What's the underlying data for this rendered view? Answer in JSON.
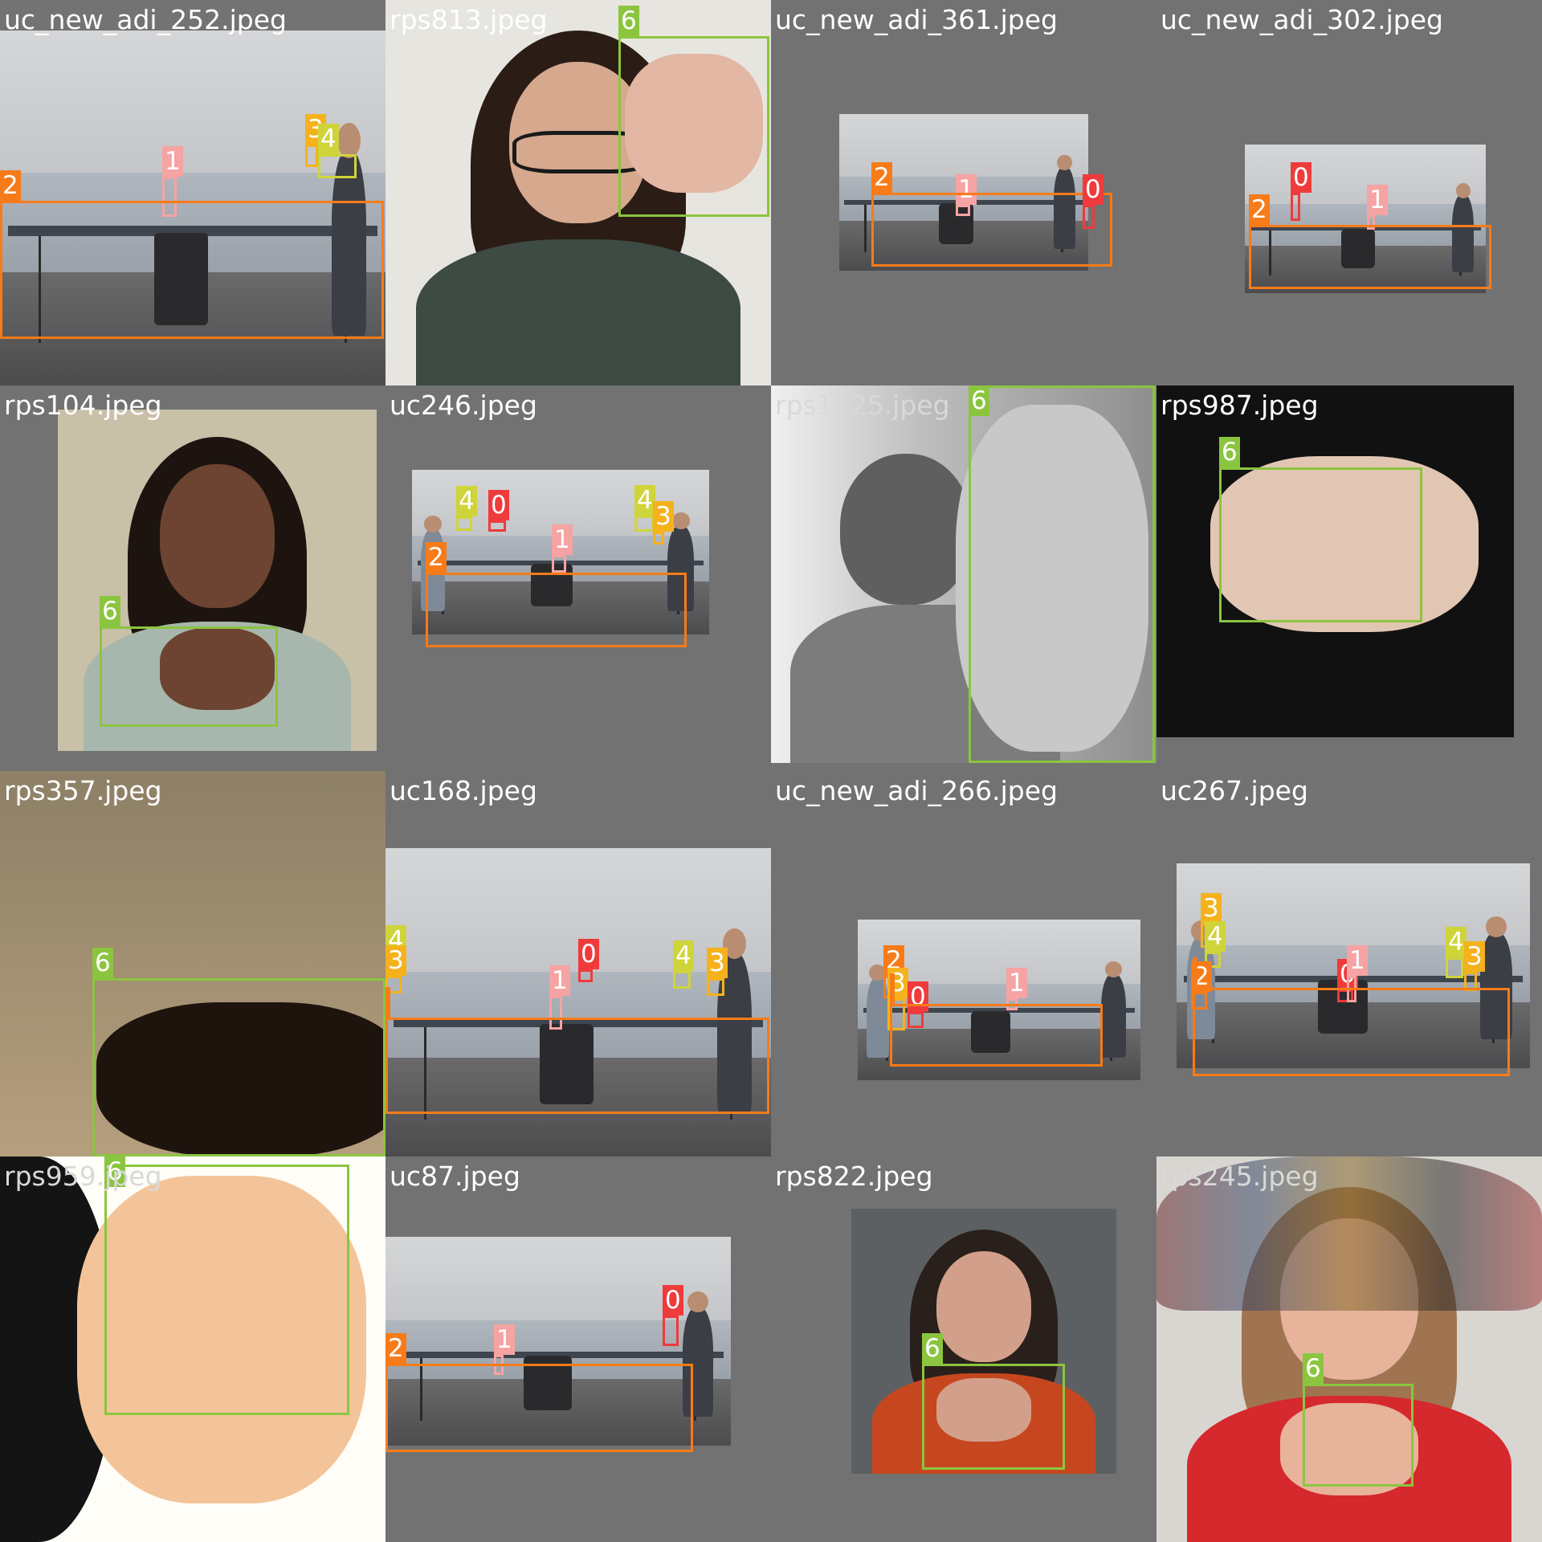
{
  "class_colors": {
    "0": "#ef3b3c",
    "1": "#f6a3a3",
    "2": "#f77b19",
    "3": "#f5b21c",
    "4": "#cfd43a",
    "6": "#8bc53f"
  },
  "tiles": [
    {
      "filename": "uc_new_adi_252.jpeg",
      "scene": "table",
      "labels": [
        "1",
        "2",
        "3",
        "4"
      ]
    },
    {
      "filename": "rps813.jpeg",
      "scene": "face",
      "labels": [
        "6"
      ]
    },
    {
      "filename": "uc_new_adi_361.jpeg",
      "scene": "table",
      "labels": [
        "1",
        "2",
        "0"
      ]
    },
    {
      "filename": "uc_new_adi_302.jpeg",
      "scene": "table",
      "labels": [
        "0",
        "1",
        "2"
      ]
    },
    {
      "filename": "rps104.jpeg",
      "scene": "face",
      "labels": [
        "6"
      ]
    },
    {
      "filename": "uc246.jpeg",
      "scene": "table",
      "labels": [
        "4",
        "0",
        "1",
        "2",
        "4",
        "3"
      ]
    },
    {
      "filename": "rps1125.jpeg",
      "scene": "gray-hand",
      "labels": [
        "6"
      ]
    },
    {
      "filename": "rps987.jpeg",
      "scene": "hand",
      "labels": [
        "6"
      ]
    },
    {
      "filename": "rps357.jpeg",
      "scene": "hand",
      "labels": [
        "6"
      ]
    },
    {
      "filename": "uc168.jpeg",
      "scene": "table",
      "labels": [
        "4",
        "3",
        "0",
        "4",
        "3",
        "1"
      ]
    },
    {
      "filename": "uc_new_adi_266.jpeg",
      "scene": "table",
      "labels": [
        "2",
        "3",
        "0",
        "1"
      ]
    },
    {
      "filename": "uc267.jpeg",
      "scene": "table",
      "labels": [
        "3",
        "4",
        "2",
        "0",
        "1",
        "4",
        "3"
      ]
    },
    {
      "filename": "rps959.jpeg",
      "scene": "hand",
      "labels": [
        "6"
      ]
    },
    {
      "filename": "uc87.jpeg",
      "scene": "table",
      "labels": [
        "1",
        "2",
        "0"
      ]
    },
    {
      "filename": "rps822.jpeg",
      "scene": "face",
      "labels": [
        "6"
      ]
    },
    {
      "filename": "rps245.jpeg",
      "scene": "face",
      "labels": [
        "6"
      ]
    }
  ]
}
